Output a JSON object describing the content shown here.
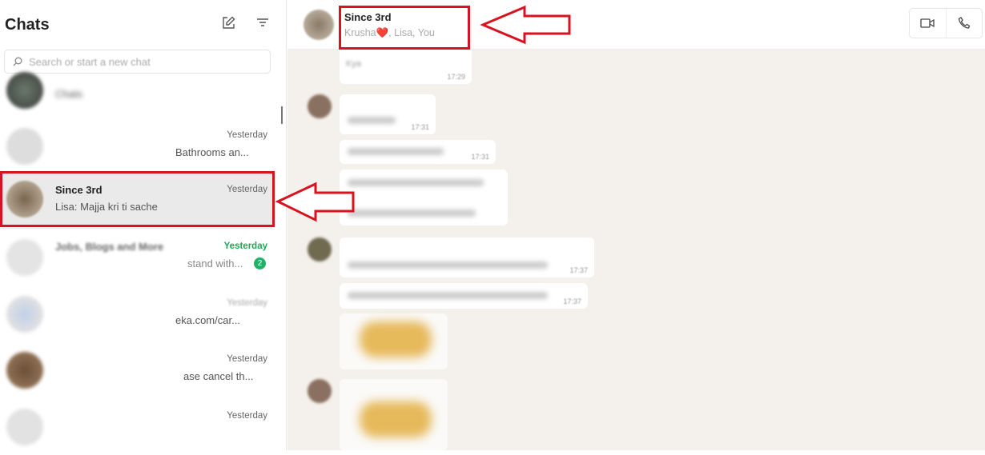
{
  "sidebar": {
    "title": "Chats",
    "search_placeholder": "Search or start a new chat",
    "chats": [
      {
        "name": "",
        "preview": "Chats",
        "time": ""
      },
      {
        "name": "",
        "preview": "Bathrooms an...",
        "time": "Yesterday"
      },
      {
        "name": "Since 3rd",
        "preview": "Lisa: Majja kri ti sache",
        "time": "Yesterday"
      },
      {
        "name": "Jobs, Blogs and More",
        "preview": "stand with...",
        "time": "Yesterday",
        "unread": "2"
      },
      {
        "name": "",
        "preview": "eka.com/car...",
        "time": "Yesterday"
      },
      {
        "name": "",
        "preview": "ase cancel th...",
        "time": "Yesterday"
      },
      {
        "name": "",
        "preview": "",
        "time": "Yesterday"
      }
    ]
  },
  "chat": {
    "name": "Since 3rd",
    "members": "Krusha❤️, Lisa, You",
    "messages": [
      {
        "text": "Kya",
        "time": "17:29"
      },
      {
        "time": "17:31"
      },
      {
        "time": "17:31"
      },
      {
        "time": "17:37"
      },
      {
        "time": "17:37"
      }
    ]
  },
  "colors": {
    "accent": "#1fa855",
    "annotation": "#d9121f"
  }
}
